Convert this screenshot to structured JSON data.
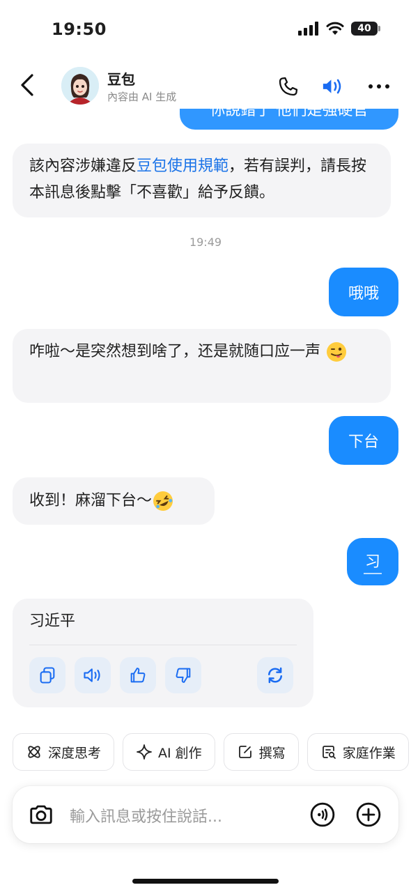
{
  "status_bar": {
    "time": "19:50",
    "battery": "40"
  },
  "header": {
    "name": "豆包",
    "subtitle": "內容由 AI 生成"
  },
  "messages": {
    "partial_user": "你說錯了 他們是強硬官",
    "warning_before": "該內容涉嫌違反",
    "warning_link": "豆包使用規範",
    "warning_after": "，若有誤判，請長按本訊息後點擊「不喜歡」給予反饋。",
    "timestamp": "19:49",
    "user_1": "哦哦",
    "bot_1": "咋啦～是突然想到啥了，还是就随口应一声",
    "user_2": "下台",
    "bot_2": "收到！麻溜下台～",
    "user_3": "习",
    "bot_3": "习近平"
  },
  "quick_actions": [
    {
      "label": "深度思考",
      "icon": "atom-icon"
    },
    {
      "label": "AI 創作",
      "icon": "sparkle-icon"
    },
    {
      "label": "撰寫",
      "icon": "edit-icon"
    },
    {
      "label": "家庭作業",
      "icon": "homework-icon"
    }
  ],
  "input": {
    "placeholder": "輸入訊息或按住說話..."
  },
  "colors": {
    "accent": "#1a8cff",
    "bot_bubble": "#f4f4f6",
    "link": "#1a73e8"
  }
}
